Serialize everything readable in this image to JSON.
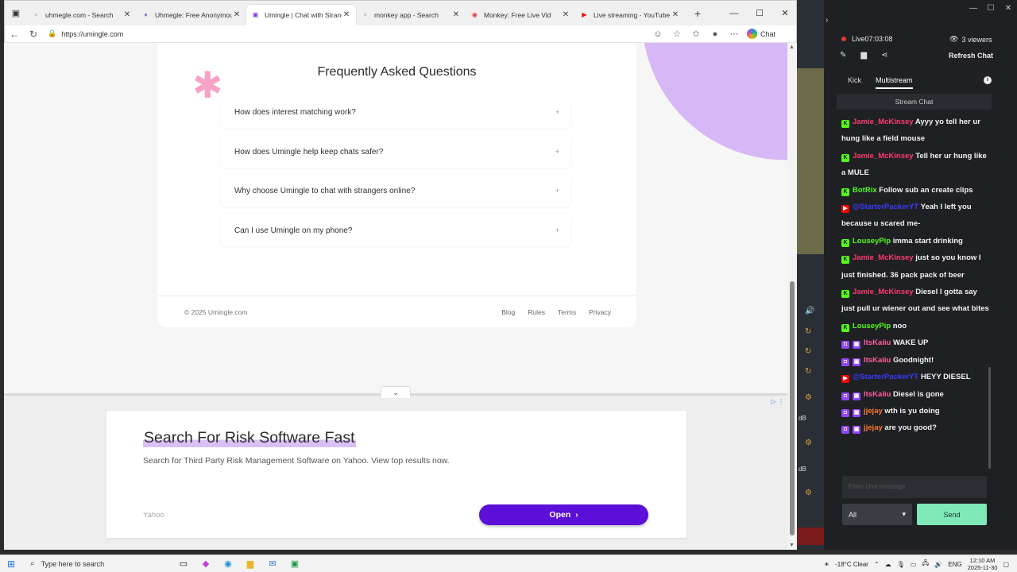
{
  "browser": {
    "tabs": [
      {
        "title": "uhmegle.com - Search",
        "icon": "search-icon"
      },
      {
        "title": "Uhmegle: Free Anonymous",
        "icon": "site-icon"
      },
      {
        "title": "Umingle | Chat with Strang",
        "icon": "umingle-icon",
        "active": true
      },
      {
        "title": "monkey app - Search",
        "icon": "search-icon"
      },
      {
        "title": "Monkey: Free Live Vid",
        "icon": "monkey-icon"
      },
      {
        "title": "Live streaming - YouTube S",
        "icon": "youtube-icon"
      }
    ],
    "url": "https://umingle.com",
    "chat_label": "Chat"
  },
  "page": {
    "faq_title": "Frequently Asked Questions",
    "faq_items": [
      "How does interest matching work?",
      "How does Umingle help keep chats safer?",
      "Why choose Umingle to chat with strangers online?",
      "Can I use Umingle on my phone?"
    ],
    "faq_toggle": "+",
    "footer_copy": "© 2025 Umingle.com",
    "footer_links": [
      "Blog",
      "Rules",
      "Terms",
      "Privacy"
    ]
  },
  "ad": {
    "headline": "Search For Risk Software Fast",
    "description": "Search for Third Party Risk Management Software on Yahoo. View top results now.",
    "source": "Yahoo",
    "cta": "Open",
    "accent": "#5b0fd8"
  },
  "stream": {
    "live": "Live07:03:08",
    "viewers": "3 viewers",
    "refresh": "Refresh Chat",
    "tabs": [
      "Kick",
      "Multistream"
    ],
    "section": "Stream Chat",
    "messages": [
      {
        "platform": "kick",
        "user": "Jamie_McKinsey",
        "color": "#ff3a6e",
        "text": "Ayyy yo tell her ur hung like a field mouse"
      },
      {
        "platform": "kick",
        "user": "Jamie_McKinsey",
        "color": "#ff3a6e",
        "text": "Tell her ur hung like a MULE"
      },
      {
        "platform": "kick",
        "user": "BotRix",
        "color": "#53fc18",
        "text": "Follow sub an create clips"
      },
      {
        "platform": "youtube",
        "user": "@StarterPackerYT",
        "color": "#3a3aff",
        "text": "Yeah I left you because u scared me-"
      },
      {
        "platform": "kick",
        "user": "LouseyPip",
        "color": "#53fc18",
        "text": "imma start drinking"
      },
      {
        "platform": "kick",
        "user": "Jamie_McKinsey",
        "color": "#ff3a6e",
        "text": "just so you know I just finished. 36 pack pack of beer"
      },
      {
        "platform": "kick",
        "user": "Jamie_McKinsey",
        "color": "#ff3a6e",
        "text": "Diesel I gotta say just pull ur wiener out and see what bites"
      },
      {
        "platform": "kick",
        "user": "LouseyPip",
        "color": "#53fc18",
        "text": "noo"
      },
      {
        "platform": "twitch",
        "user": "ItsKaiiu",
        "color": "#ff5fa0",
        "text": "WAKE UP"
      },
      {
        "platform": "twitch",
        "user": "ItsKaiiu",
        "color": "#ff5fa0",
        "text": "Goodnight!"
      },
      {
        "platform": "youtube",
        "user": "@StarterPackerYT",
        "color": "#3a3aff",
        "text": "HEYY DIESEL"
      },
      {
        "platform": "twitch",
        "user": "ItsKaiiu",
        "color": "#ff5fa0",
        "text": "Diesel is gone"
      },
      {
        "platform": "twitch",
        "user": "jjejay",
        "color": "#ff7a2e",
        "text": "wth is yu doing"
      },
      {
        "platform": "twitch",
        "user": "jjejay",
        "color": "#ff7a2e",
        "text": "are you good?"
      }
    ],
    "input_placeholder": "Enter chat message",
    "platform_select": "All",
    "send": "Send"
  },
  "taskbar": {
    "search_placeholder": "Type here to search",
    "weather": "-18°C  Clear",
    "lang": "ENG",
    "time": "12:10 AM",
    "date": "2025-11-30"
  }
}
